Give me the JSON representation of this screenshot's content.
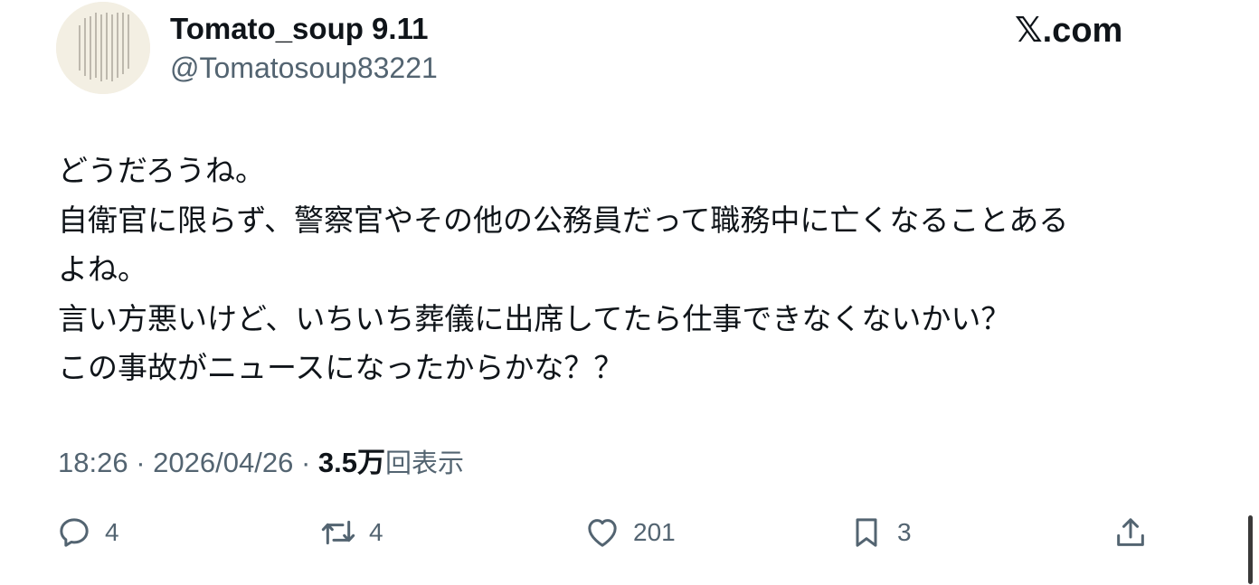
{
  "author": {
    "display_name": "Tomato_soup 9.11",
    "handle": "@Tomatosoup83221"
  },
  "brand": {
    "x_glyph": "𝕏",
    "domain": ".com"
  },
  "tweet": {
    "lines": [
      "どうだろうね。",
      "自衛官に限らず、警察官やその他の公務員だって職務中に亡くなることある",
      "よね。",
      "言い方悪いけど、いちいち葬儀に出席してたら仕事できなくないかい？",
      "この事故がニュースになったからかな？？"
    ]
  },
  "meta": {
    "time": "18:26",
    "date": "2026/04/26",
    "separator": "·",
    "views_count": "3.5万",
    "views_label": "回表示"
  },
  "actions": {
    "reply_count": "4",
    "repost_count": "4",
    "like_count": "201",
    "bookmark_count": "3"
  },
  "icons": {
    "reply": "speech-bubble-icon",
    "repost": "repost-arrows-icon",
    "like": "heart-icon",
    "bookmark": "bookmark-icon",
    "share": "share-upload-icon"
  },
  "colors": {
    "text": "#0f1419",
    "secondary": "#536471",
    "background": "#ffffff"
  }
}
